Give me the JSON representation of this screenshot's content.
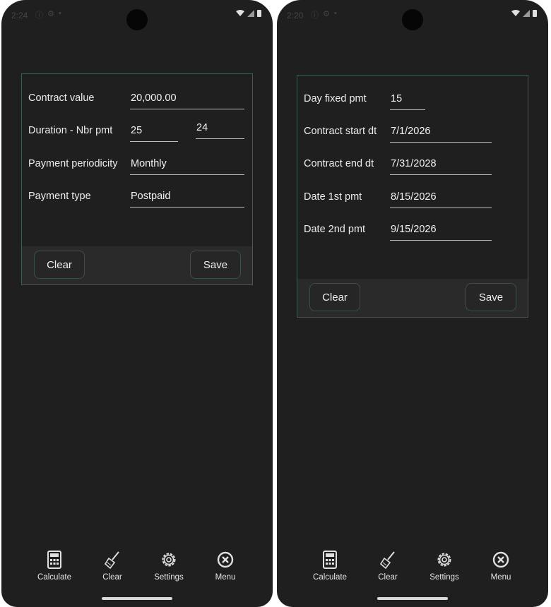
{
  "left": {
    "status": {
      "time": "2:24",
      "icons": [
        "info-icon",
        "gear-icon",
        "notification-icon"
      ]
    },
    "form": {
      "contract_value": {
        "label": "Contract value",
        "value": "20,000.00"
      },
      "duration": {
        "label": "Duration - Nbr pmt",
        "value": "25",
        "value2": "24"
      },
      "periodicity": {
        "label": "Payment periodicity",
        "value": "Monthly"
      },
      "payment_type": {
        "label": "Payment type",
        "value": "Postpaid"
      }
    },
    "buttons": {
      "clear": "Clear",
      "save": "Save"
    },
    "nav": {
      "calculate": "Calculate",
      "clear": "Clear",
      "settings": "Settings",
      "menu": "Menu"
    }
  },
  "right": {
    "status": {
      "time": "2:20",
      "icons": [
        "info-icon",
        "gear-icon",
        "notification-icon"
      ]
    },
    "form": {
      "day_fixed": {
        "label": "Day fixed pmt",
        "value": "15"
      },
      "start": {
        "label": "Contract start dt",
        "value": "7/1/2026"
      },
      "end": {
        "label": "Contract end dt",
        "value": "7/31/2028"
      },
      "first_pmt": {
        "label": "Date 1st pmt",
        "value": "8/15/2026"
      },
      "second_pmt": {
        "label": "Date 2nd pmt",
        "value": "9/15/2026"
      }
    },
    "buttons": {
      "clear": "Clear",
      "save": "Save"
    },
    "nav": {
      "calculate": "Calculate",
      "clear": "Clear",
      "settings": "Settings",
      "menu": "Menu"
    }
  },
  "colors": {
    "background": "#1f1f1f",
    "card_border": "#3f5b54",
    "button_bar": "#2a2a2a",
    "text": "#e8e8e8"
  }
}
